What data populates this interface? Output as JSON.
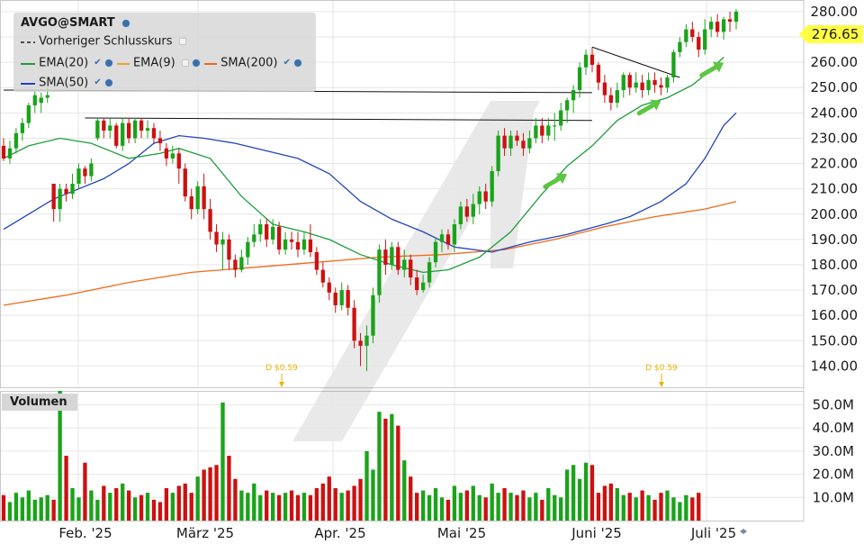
{
  "symbol": "AVGO@SMART",
  "legend": {
    "prev_close": "Vorheriger Schlusskurs",
    "ema20": "EMA(20)",
    "ema9": "EMA(9)",
    "sma200": "SMA(200)",
    "sma50": "SMA(50)"
  },
  "last_price": "276.65",
  "volume_label": "Volumen",
  "dividend_labels": [
    "D $0.59",
    "D $0.59"
  ],
  "colors": {
    "up": "#1aa31a",
    "down": "#cc1111",
    "neutral": "#f2e600",
    "ema20": "#1e9e3e",
    "ema9": "#f0a030",
    "sma200": "#f06a1a",
    "sma50": "#2244bb",
    "arrow": "#5cc640",
    "dividend": "#e8b400",
    "price_tag": "#ffff44"
  },
  "chart_data": {
    "type": "candlestick",
    "x_ticks": [
      "Feb. '25",
      "März '25",
      "Apr. '25",
      "Mai '25",
      "Juni '25",
      "Juli '25"
    ],
    "price_axis": {
      "ticks": [
        140,
        150,
        160,
        170,
        180,
        190,
        200,
        210,
        220,
        230,
        240,
        250,
        260,
        270,
        280
      ],
      "range": [
        131.6,
        284.6
      ]
    },
    "volume_axis": {
      "ticks": [
        "10.0M",
        "20.0M",
        "30.0M",
        "40.0M",
        "50.0M"
      ],
      "range_millions": [
        0,
        56
      ]
    },
    "candles": [
      [
        227,
        222,
        230,
        221
      ],
      [
        222,
        226,
        229,
        220
      ],
      [
        226,
        232,
        234,
        224
      ],
      [
        232,
        236,
        238,
        229
      ],
      [
        236,
        243,
        244,
        234
      ],
      [
        243,
        247,
        249,
        240
      ],
      [
        244,
        246,
        248,
        240
      ],
      [
        246,
        247,
        250,
        244
      ],
      [
        212,
        202,
        212,
        197
      ],
      [
        202,
        210,
        212,
        197
      ],
      [
        210,
        208,
        212,
        205
      ],
      [
        208,
        212,
        216,
        206
      ],
      [
        212,
        218,
        220,
        210
      ],
      [
        218,
        215,
        219,
        212
      ],
      [
        215,
        220,
        222,
        213
      ],
      [
        230,
        237,
        238,
        229
      ],
      [
        237,
        233,
        238,
        230
      ],
      [
        233,
        235,
        238,
        230
      ],
      [
        235,
        227,
        236,
        226
      ],
      [
        227,
        236,
        238,
        225
      ],
      [
        236,
        230,
        238,
        228
      ],
      [
        230,
        237,
        238,
        228
      ],
      [
        237,
        233,
        238,
        230
      ],
      [
        233,
        234,
        237,
        230
      ],
      [
        234,
        230,
        236,
        228
      ],
      [
        230,
        228,
        233,
        225
      ],
      [
        226,
        222,
        228,
        219
      ],
      [
        222,
        224,
        227,
        220
      ],
      [
        224,
        218,
        226,
        212
      ],
      [
        218,
        207,
        220,
        205
      ],
      [
        207,
        202,
        210,
        198
      ],
      [
        202,
        211,
        213,
        200
      ],
      [
        211,
        202,
        216,
        198
      ],
      [
        202,
        193,
        206,
        190
      ],
      [
        193,
        188,
        196,
        185
      ],
      [
        188,
        190,
        193,
        178
      ],
      [
        190,
        182,
        192,
        178
      ],
      [
        182,
        178,
        184,
        175
      ],
      [
        178,
        183,
        186,
        177
      ],
      [
        183,
        189,
        191,
        180
      ],
      [
        189,
        192,
        196,
        187
      ],
      [
        192,
        196,
        198,
        189
      ],
      [
        196,
        190,
        198,
        187
      ],
      [
        190,
        195,
        198,
        188
      ],
      [
        195,
        186,
        197,
        184
      ],
      [
        186,
        190,
        193,
        184
      ],
      [
        190,
        189,
        193,
        186
      ],
      [
        189,
        186,
        193,
        183
      ],
      [
        186,
        190,
        193,
        184
      ],
      [
        190,
        185,
        196,
        183
      ],
      [
        185,
        178,
        187,
        176
      ],
      [
        178,
        173,
        181,
        171
      ],
      [
        173,
        169,
        175,
        166
      ],
      [
        169,
        164,
        171,
        161
      ],
      [
        164,
        170,
        173,
        162
      ],
      [
        170,
        163,
        172,
        160
      ],
      [
        163,
        150,
        166,
        147
      ],
      [
        150,
        148,
        153,
        140
      ],
      [
        148,
        152,
        156,
        138
      ],
      [
        152,
        168,
        171,
        149
      ],
      [
        168,
        186,
        188,
        165
      ],
      [
        186,
        180,
        190,
        176
      ],
      [
        180,
        187,
        189,
        178
      ],
      [
        187,
        178,
        189,
        176
      ],
      [
        178,
        182,
        186,
        175
      ],
      [
        182,
        175,
        184,
        172
      ],
      [
        175,
        170,
        178,
        168
      ],
      [
        170,
        173,
        176,
        169
      ],
      [
        173,
        181,
        183,
        171
      ],
      [
        181,
        189,
        191,
        179
      ],
      [
        189,
        192,
        194,
        185
      ],
      [
        192,
        188,
        194,
        186
      ],
      [
        188,
        196,
        198,
        185
      ],
      [
        196,
        203,
        205,
        194
      ],
      [
        203,
        199,
        206,
        197
      ],
      [
        199,
        204,
        208,
        196
      ],
      [
        204,
        209,
        211,
        200
      ],
      [
        209,
        205,
        212,
        202
      ],
      [
        205,
        217,
        219,
        203
      ],
      [
        217,
        231,
        233,
        215
      ],
      [
        231,
        226,
        234,
        223
      ],
      [
        226,
        231,
        233,
        223
      ],
      [
        231,
        229,
        233,
        227
      ],
      [
        229,
        226,
        232,
        223
      ],
      [
        226,
        230,
        233,
        224
      ],
      [
        230,
        235,
        238,
        228
      ],
      [
        235,
        231,
        238,
        228
      ],
      [
        231,
        235,
        238,
        229
      ],
      [
        235,
        235,
        240,
        229
      ],
      [
        235,
        241,
        244,
        233
      ],
      [
        241,
        245,
        246,
        236
      ],
      [
        245,
        249,
        251,
        240
      ],
      [
        249,
        258,
        260,
        246
      ],
      [
        258,
        263,
        265,
        255
      ],
      [
        263,
        259,
        266,
        256
      ],
      [
        259,
        252,
        260,
        249
      ],
      [
        252,
        247,
        255,
        244
      ],
      [
        247,
        244,
        250,
        241
      ],
      [
        244,
        249,
        252,
        242
      ],
      [
        249,
        255,
        256,
        246
      ],
      [
        255,
        250,
        256,
        247
      ],
      [
        250,
        252,
        256,
        248
      ],
      [
        252,
        249,
        255,
        246
      ],
      [
        249,
        253,
        256,
        247
      ],
      [
        253,
        251,
        256,
        248
      ],
      [
        251,
        250,
        254,
        247
      ],
      [
        250,
        254,
        255,
        248
      ],
      [
        254,
        264,
        265,
        252
      ],
      [
        264,
        268,
        270,
        262
      ],
      [
        268,
        273,
        275,
        266
      ],
      [
        273,
        270,
        276,
        268
      ],
      [
        270,
        265,
        272,
        262
      ],
      [
        265,
        273,
        277,
        263
      ],
      [
        273,
        276,
        278,
        270
      ],
      [
        276,
        272,
        279,
        270
      ],
      [
        272,
        277,
        278,
        269
      ],
      [
        277,
        276,
        280,
        272
      ],
      [
        276,
        280,
        281,
        273
      ]
    ],
    "volume_millions": [
      11,
      8,
      12,
      10,
      13,
      9,
      10,
      11,
      9,
      56,
      28,
      14,
      10,
      25,
      13,
      9,
      15,
      12,
      14,
      16,
      13,
      10,
      11,
      12,
      9,
      8,
      14,
      12,
      15,
      16,
      12,
      19,
      22,
      23,
      24,
      51,
      28,
      18,
      13,
      12,
      16,
      11,
      13,
      12,
      11,
      12,
      13,
      11,
      12,
      11,
      14,
      16,
      19,
      14,
      12,
      13,
      15,
      18,
      30,
      22,
      47,
      44,
      46,
      41,
      26,
      19,
      12,
      13,
      11,
      14,
      10,
      9,
      15,
      12,
      13,
      15,
      11,
      10,
      16,
      12,
      14,
      12,
      11,
      13,
      10,
      12,
      9,
      14,
      11,
      10,
      22,
      24,
      18,
      25,
      24,
      12,
      15,
      16,
      14,
      11,
      12,
      10,
      13,
      11,
      9,
      12,
      13,
      10,
      8,
      11,
      10,
      12
    ],
    "ema20": [
      [
        0,
        222
      ],
      [
        4,
        227
      ],
      [
        9,
        230
      ],
      [
        14,
        228
      ],
      [
        20,
        222
      ],
      [
        25,
        224
      ],
      [
        28,
        226
      ],
      [
        33,
        222
      ],
      [
        38,
        207
      ],
      [
        43,
        196
      ],
      [
        48,
        193
      ],
      [
        52,
        190
      ],
      [
        57,
        184
      ],
      [
        62,
        180
      ],
      [
        67,
        177
      ],
      [
        71,
        178
      ],
      [
        76,
        183
      ],
      [
        81,
        193
      ],
      [
        86,
        208
      ],
      [
        90,
        219
      ],
      [
        94,
        227
      ],
      [
        98,
        237
      ],
      [
        102,
        243
      ],
      [
        106,
        246
      ],
      [
        110,
        251
      ],
      [
        112,
        255
      ],
      [
        115,
        262
      ]
    ],
    "sma50": [
      [
        0,
        194
      ],
      [
        4,
        200
      ],
      [
        8,
        206
      ],
      [
        12,
        210
      ],
      [
        16,
        214
      ],
      [
        20,
        220
      ],
      [
        24,
        228
      ],
      [
        28,
        231
      ],
      [
        32,
        230
      ],
      [
        37,
        228
      ],
      [
        42,
        225
      ],
      [
        47,
        222
      ],
      [
        52,
        216
      ],
      [
        57,
        205
      ],
      [
        62,
        198
      ],
      [
        67,
        193
      ],
      [
        72,
        187
      ],
      [
        78,
        185
      ],
      [
        84,
        189
      ],
      [
        90,
        192
      ],
      [
        96,
        196
      ],
      [
        100,
        199
      ],
      [
        105,
        205
      ],
      [
        109,
        212
      ],
      [
        112,
        222
      ],
      [
        115,
        235
      ],
      [
        117,
        240
      ]
    ],
    "sma200": [
      [
        0,
        164
      ],
      [
        10,
        168
      ],
      [
        20,
        173
      ],
      [
        30,
        177
      ],
      [
        40,
        179
      ],
      [
        50,
        181
      ],
      [
        60,
        183
      ],
      [
        70,
        184
      ],
      [
        80,
        186
      ],
      [
        88,
        190
      ],
      [
        96,
        195
      ],
      [
        104,
        199
      ],
      [
        112,
        202
      ],
      [
        117,
        205
      ]
    ],
    "ema9": [
      [
        68,
        184
      ],
      [
        76,
        184
      ],
      [
        82,
        188
      ]
    ],
    "prev_close": 276.65,
    "resistance_lines": [
      [
        [
          0,
          249
        ],
        [
          94,
          248
        ]
      ],
      [
        [
          13,
          238
        ],
        [
          94,
          237
        ]
      ]
    ],
    "triangle_upper": [
      [
        94,
        266
      ],
      [
        108,
        254
      ]
    ],
    "dividend_markers": [
      43,
      106
    ],
    "trend_arrows": [
      [
        88,
        213
      ],
      [
        103,
        242
      ],
      [
        113,
        257
      ]
    ]
  }
}
